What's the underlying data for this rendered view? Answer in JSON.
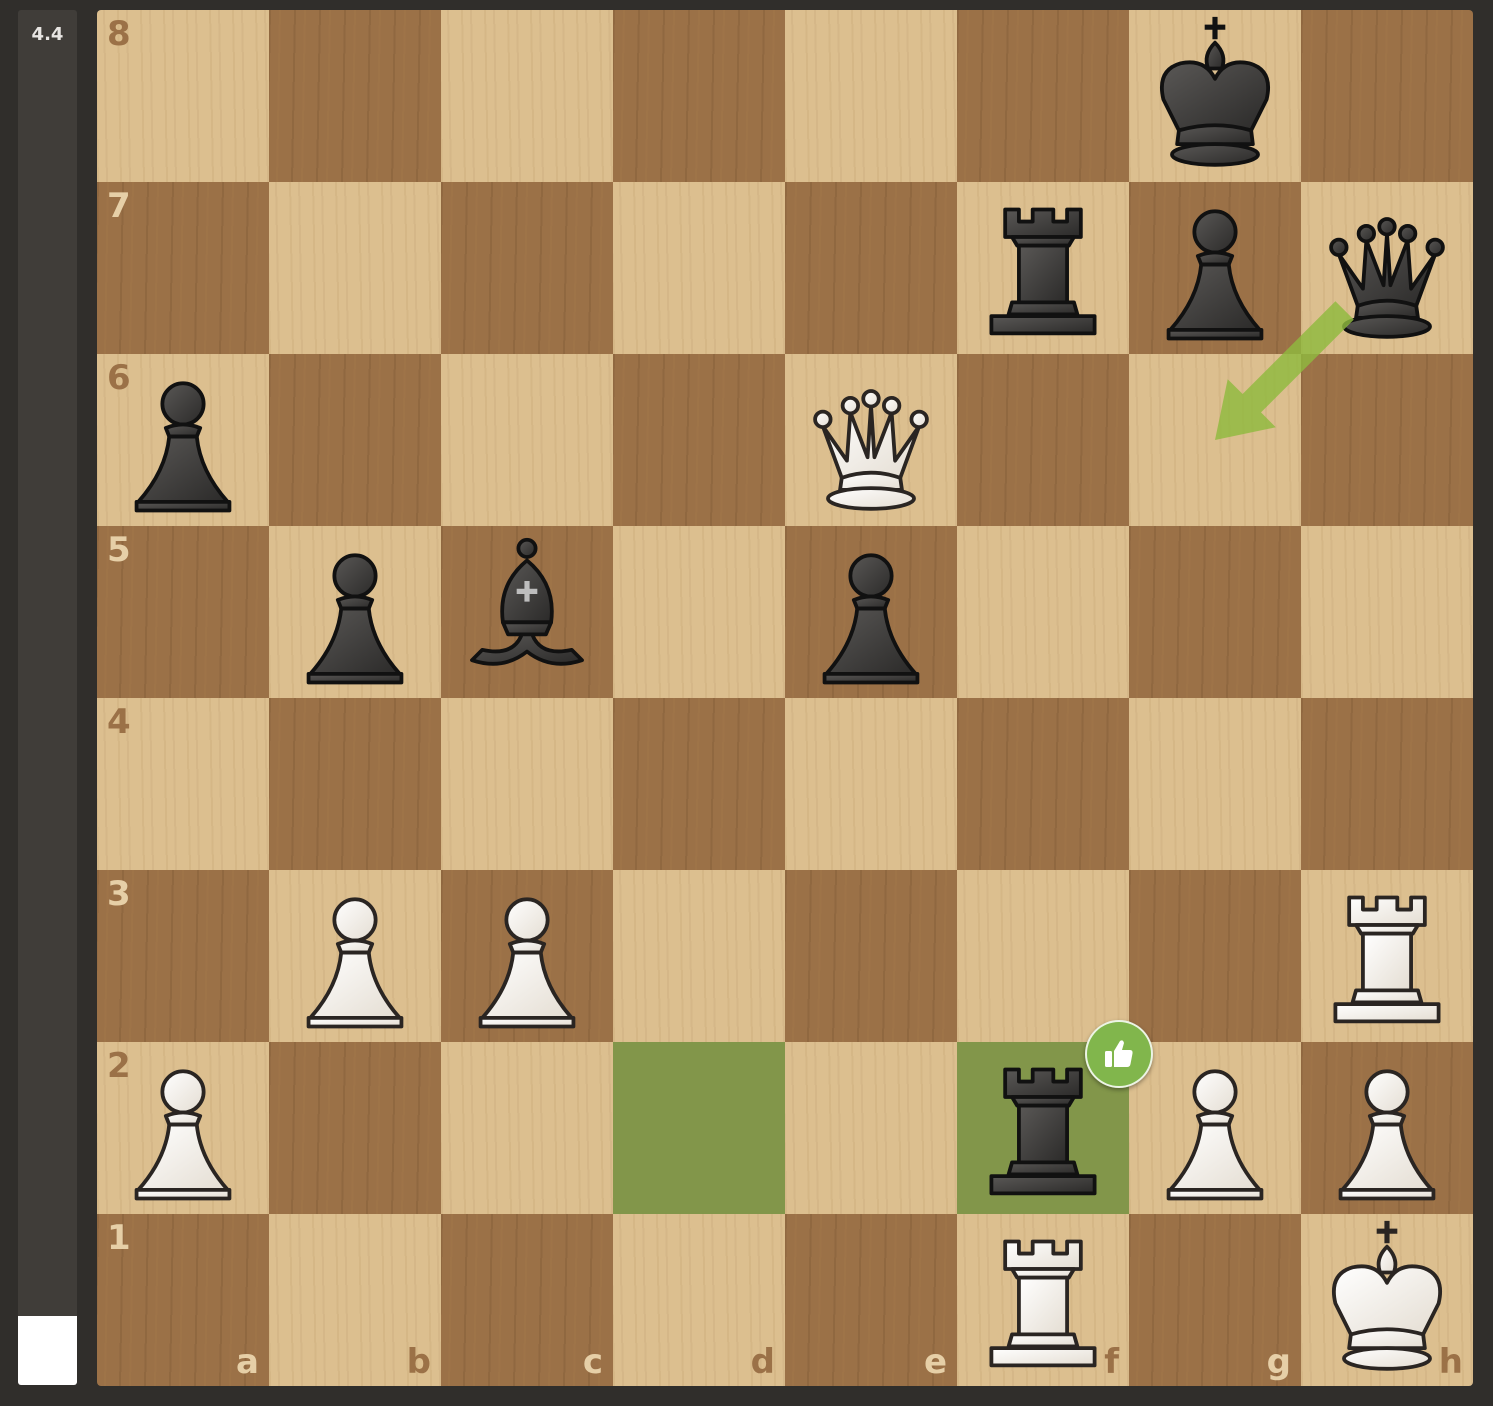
{
  "evaluation": {
    "score": "4.4",
    "white_fraction": 0.05
  },
  "board": {
    "files": [
      "a",
      "b",
      "c",
      "d",
      "e",
      "f",
      "g",
      "h"
    ],
    "ranks": [
      "8",
      "7",
      "6",
      "5",
      "4",
      "3",
      "2",
      "1"
    ],
    "pieces": [
      {
        "square": "g8",
        "color": "black",
        "type": "king"
      },
      {
        "square": "f7",
        "color": "black",
        "type": "rook"
      },
      {
        "square": "g7",
        "color": "black",
        "type": "pawn"
      },
      {
        "square": "h7",
        "color": "black",
        "type": "queen"
      },
      {
        "square": "a6",
        "color": "black",
        "type": "pawn"
      },
      {
        "square": "e6",
        "color": "white",
        "type": "queen"
      },
      {
        "square": "b5",
        "color": "black",
        "type": "pawn"
      },
      {
        "square": "c5",
        "color": "black",
        "type": "bishop"
      },
      {
        "square": "e5",
        "color": "black",
        "type": "pawn"
      },
      {
        "square": "b3",
        "color": "white",
        "type": "pawn"
      },
      {
        "square": "c3",
        "color": "white",
        "type": "pawn"
      },
      {
        "square": "h3",
        "color": "white",
        "type": "rook"
      },
      {
        "square": "a2",
        "color": "white",
        "type": "pawn"
      },
      {
        "square": "f2",
        "color": "black",
        "type": "rook"
      },
      {
        "square": "g2",
        "color": "white",
        "type": "pawn"
      },
      {
        "square": "h2",
        "color": "white",
        "type": "pawn"
      },
      {
        "square": "f1",
        "color": "white",
        "type": "rook"
      },
      {
        "square": "h1",
        "color": "white",
        "type": "king"
      }
    ],
    "last_move_highlights": [
      "d2",
      "f2"
    ],
    "suggested_arrow": {
      "from": "h7",
      "to": "g6",
      "color": "#8fb93e"
    },
    "move_badge": {
      "square": "f2",
      "type": "good",
      "icon": "thumbs-up-icon",
      "color": "#81b64c"
    }
  }
}
